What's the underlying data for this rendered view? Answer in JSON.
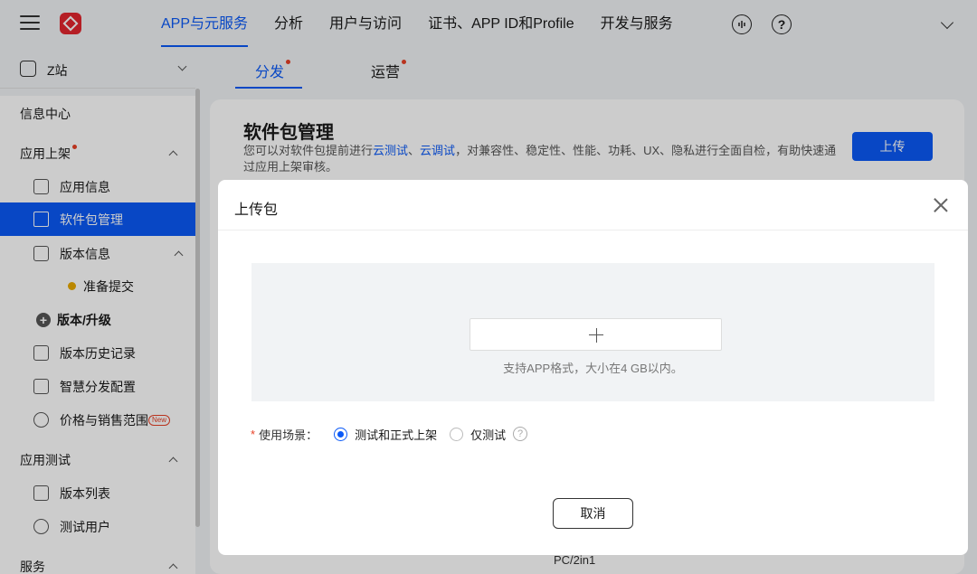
{
  "topnav": {
    "items": [
      "APP与元服务",
      "分析",
      "用户与访问",
      "证书、APP ID和Profile",
      "开发与服务"
    ],
    "active_index": 0,
    "help_icon_text": "?"
  },
  "sidebar": {
    "site_name": "Z站",
    "items": [
      {
        "label": "信息中心"
      },
      {
        "label": "应用上架"
      },
      {
        "label": "应用信息"
      },
      {
        "label": "软件包管理"
      },
      {
        "label": "版本信息"
      },
      {
        "label": "准备提交"
      },
      {
        "label": "版本/升级"
      },
      {
        "label": "版本历史记录"
      },
      {
        "label": "智慧分发配置"
      },
      {
        "label": "价格与销售范围",
        "badge": "New"
      },
      {
        "label": "应用测试"
      },
      {
        "label": "版本列表"
      },
      {
        "label": "测试用户"
      },
      {
        "label": "服务"
      }
    ]
  },
  "subtabs": {
    "items": [
      "分发",
      "运营"
    ]
  },
  "main": {
    "title": "软件包管理",
    "desc_prefix": "您可以对软件包提前进行",
    "link1": "云测试",
    "sep": "、",
    "link2": "云调试",
    "desc_suffix": "，对兼容性、稳定性、性能、功耗、UX、隐私进行全面自检，有助快速通过应用上架审核。",
    "upload_label": "上传",
    "under_text": "PC/2in1"
  },
  "dialog": {
    "title": "上传包",
    "hint": "支持APP格式，大小在4 GB以内。",
    "required_mark": "*",
    "field_label": "使用场景：",
    "options": [
      "测试和正式上架",
      "仅测试"
    ],
    "selected_option": 0,
    "help_text": "?",
    "cancel_label": "取消"
  },
  "colors": {
    "accent": "#0a59f7",
    "required": "#e84026",
    "badge": "#e84026",
    "logo": "#e3262f",
    "pending_dot": "#e9a900"
  }
}
